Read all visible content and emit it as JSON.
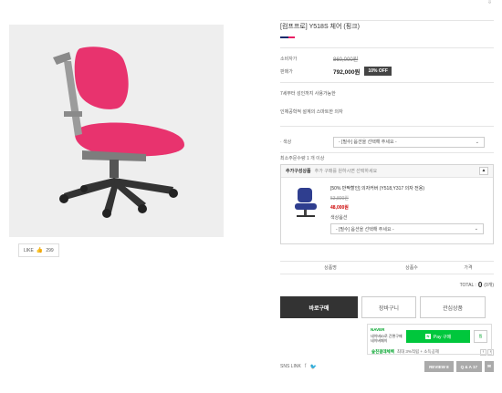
{
  "product": {
    "title": "[컴프프로] Y518S 체어 (핑크)",
    "rule_colors": [
      "#1a2a6c",
      "#e91e63"
    ],
    "like_label": "LIKE",
    "like_count": "299",
    "consumer_price_label": "소비자가",
    "consumer_price": "860,000원",
    "sale_price_label": "판매가",
    "sale_price": "792,000원",
    "discount_badge": "10% OFF",
    "note1": "7세부터 성인까지 사용가능한",
    "note2": "인체공학적 설계의 스마트한 의자",
    "option_label": "· 색상",
    "option_placeholder": "- [필수] 옵션을 선택해 주세요 -",
    "min_qty": "최소주문수량 1 개 이상"
  },
  "addon": {
    "heading": "추가구성상품",
    "subheading": "추가 구매를 원하시면 선택하세요",
    "toggle": "▲",
    "name": "[50% 반짝할인] 의자커버 (Y518,Y317 의자 전용)",
    "orig_price": "53,800원",
    "price": "48,000원",
    "option_label": "색상옵션",
    "option_placeholder": "- [필수] 옵션을 선택해 주세요 -"
  },
  "table": {
    "col_name": "상품명",
    "col_qty": "상품수",
    "col_price": "가격"
  },
  "total": {
    "label": "TOTAL :",
    "value": "0",
    "count": "(0개)"
  },
  "buttons": {
    "buy": "바로구매",
    "cart": "장바구니",
    "wish": "관심상품"
  },
  "npay": {
    "logo": "NAVER",
    "sub": "네이버ID로 간편구매 네이버페이",
    "pay_label": "Pay 구매",
    "pay_mark": "N",
    "zzim": "찜",
    "event_bold": "숲친걸데체벡",
    "event_text": "최대 3%적립 + 소득공제"
  },
  "footer": {
    "sns_label": "SNS LINK",
    "review": "REVIEW 8",
    "qna": "Q & A 17"
  }
}
